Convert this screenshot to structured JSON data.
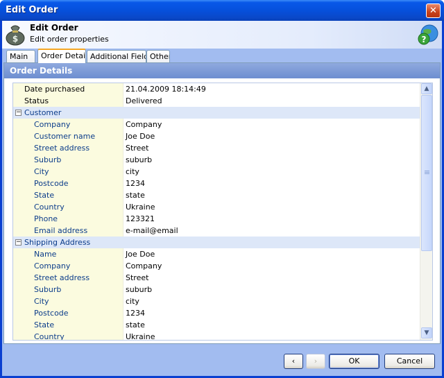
{
  "window": {
    "title": "Edit Order",
    "close_glyph": "✕"
  },
  "header": {
    "title": "Edit Order",
    "subtitle": "Edit order properties",
    "app_icon": "money-bag-icon",
    "help_icon": "help-globe-icon",
    "help_glyph": "?"
  },
  "tabs": [
    "Main",
    "Order Details",
    "Additional Fields",
    "Other"
  ],
  "active_tab": "Order Details",
  "panel": {
    "title": "Order Details"
  },
  "grid": {
    "top": [
      {
        "name": "Date purchased",
        "value": "21.04.2009 18:14:49"
      },
      {
        "name": "Status",
        "value": "Delivered"
      }
    ],
    "customer": {
      "label": "Customer",
      "expander": "−",
      "rows": [
        {
          "name": "Company",
          "value": "Company"
        },
        {
          "name": "Customer name",
          "value": "Joe Doe"
        },
        {
          "name": "Street address",
          "value": "Street"
        },
        {
          "name": "Suburb",
          "value": "suburb"
        },
        {
          "name": "City",
          "value": "city"
        },
        {
          "name": "Postcode",
          "value": "1234"
        },
        {
          "name": "State",
          "value": "state"
        },
        {
          "name": "Country",
          "value": "Ukraine"
        },
        {
          "name": "Phone",
          "value": "123321"
        },
        {
          "name": "Email address",
          "value": "e-mail@email"
        }
      ]
    },
    "shipping": {
      "label": "Shipping Address",
      "expander": "−",
      "rows": [
        {
          "name": "Name",
          "value": "Joe Doe"
        },
        {
          "name": "Company",
          "value": "Company"
        },
        {
          "name": "Street address",
          "value": "Street"
        },
        {
          "name": "Suburb",
          "value": "suburb"
        },
        {
          "name": "City",
          "value": "city"
        },
        {
          "name": "Postcode",
          "value": "1234"
        },
        {
          "name": "State",
          "value": "state"
        },
        {
          "name": "Country",
          "value": "Ukraine"
        }
      ]
    },
    "scroll_up": "▲",
    "scroll_down": "▼"
  },
  "footer": {
    "prev_glyph": "‹",
    "next_glyph": "›",
    "ok_label": "OK",
    "cancel_label": "Cancel"
  }
}
